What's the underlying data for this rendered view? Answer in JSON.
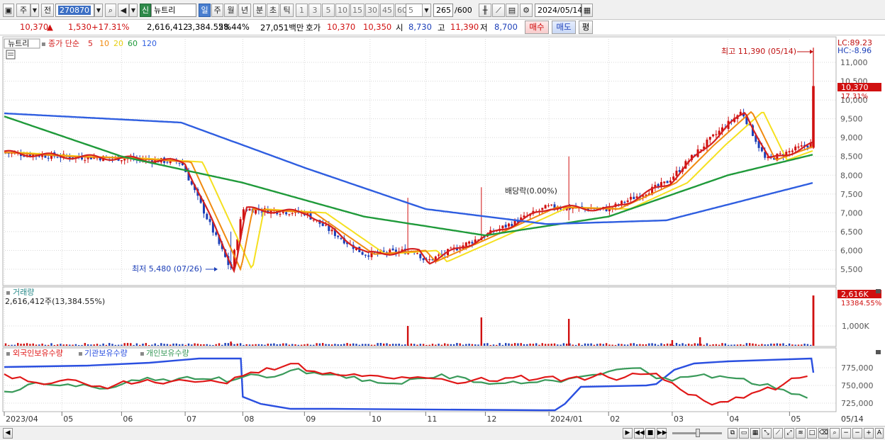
{
  "toolbar": {
    "period_week": "주",
    "prev_label": "전",
    "stock_code": "270870",
    "sin_label": "신",
    "stock_name": "뉴트리",
    "periods": [
      "일",
      "주",
      "월",
      "년",
      "분",
      "초",
      "틱"
    ],
    "active_period": "일",
    "intervals": [
      "1",
      "3",
      "5",
      "10",
      "15",
      "30",
      "45",
      "60"
    ],
    "interval_value": "5",
    "count_value": "265",
    "count_max": "/600",
    "date": "2024/05/14"
  },
  "quote": {
    "price": "10,370",
    "change_arrow": "▲",
    "change": "1,530",
    "change_pct": "+17.31%",
    "volume": "2,616,412",
    "volume_ratio": "3,384.55%",
    "turnover_ratio": "28.44%",
    "amount": "27,051백만",
    "hoga_label": "호가",
    "ask": "10,370",
    "bid": "10,350",
    "open_label": "시",
    "open": "8,730",
    "high_label": "고",
    "high": "11,390",
    "low_label": "저",
    "low": "8,700",
    "buy_button": "매수",
    "sell_button": "매도",
    "eval_button": "평"
  },
  "price_panel": {
    "stock_label": "뉴트리",
    "legend": {
      "close_label": "종가 단순",
      "ma5": "5",
      "ma10": "10",
      "ma20": "20",
      "ma60": "60",
      "ma120": "120"
    },
    "lc_label": "LC:89.23",
    "hc_label": "HC:-8.96",
    "high_annotation": "최고 11,390 (05/14)",
    "low_annotation": "최저 5,480 (07/26)",
    "dividend_annotation": "배당락(0.00%)",
    "current_price_tag": "10,370",
    "current_pct_tag": "17.31%",
    "y_ticks": [
      "11,000",
      "10,500",
      "10,000",
      "9,500",
      "9,000",
      "8,500",
      "8,000",
      "7,500",
      "7,000",
      "6,500",
      "6,000",
      "5,500"
    ]
  },
  "volume_panel": {
    "title": "거래량",
    "value_text": "2,616,412주(13,384.55%)",
    "current_tag": "2,616K",
    "ratio_tag": "13384.55%",
    "y_ticks": [
      "1,000K"
    ]
  },
  "holding_panel": {
    "legend_foreign": "외국인보유수량",
    "legend_institution": "기관보유수량",
    "legend_individual": "개인보유수량",
    "y_ticks": [
      "775,000",
      "750,000",
      "725,000"
    ]
  },
  "x_axis": {
    "labels": [
      "2023/04",
      "05",
      "06",
      "07",
      "08",
      "09",
      "10",
      "11",
      "12",
      "2024/01",
      "02",
      "03",
      "04",
      "05",
      "05/14"
    ]
  },
  "colors": {
    "up": "#d01010",
    "down": "#1c3fb8",
    "ma5": "#d42020",
    "ma10": "#f08a10",
    "ma20": "#f5e020",
    "ma60": "#1f9a3a",
    "ma120": "#2f5ee0",
    "foreign": "#e01818",
    "institution": "#2a4fe0",
    "individual": "#3a9a5a"
  },
  "chart_data": {
    "type": "line",
    "title": "",
    "x_range": [
      "2023/04",
      "2024/05/14"
    ],
    "ylim_price": [
      5300,
      11400
    ],
    "series": [
      {
        "name": "종가",
        "points": [
          [
            "2023/04",
            8600
          ],
          [
            "2023/05",
            8500
          ],
          [
            "2023/06",
            8450
          ],
          [
            "2023/07",
            8350
          ],
          [
            "2023/07/26",
            5480
          ],
          [
            "2023/08",
            7100
          ],
          [
            "2023/09",
            7000
          ],
          [
            "2023/10",
            5900
          ],
          [
            "2023/10/27",
            6000
          ],
          [
            "2023/11",
            5700
          ],
          [
            "2023/12",
            6400
          ],
          [
            "2024/01",
            7150
          ],
          [
            "2024/02",
            7100
          ],
          [
            "2024/03",
            7800
          ],
          [
            "2024/03/20",
            8800
          ],
          [
            "2024/04/08",
            9700
          ],
          [
            "2024/04/20",
            8400
          ],
          [
            "2024/05/13",
            8840
          ],
          [
            "2024/05/14",
            10370
          ]
        ]
      },
      {
        "name": "5",
        "points": [
          [
            "2023/04",
            8600
          ],
          [
            "2023/07/26",
            6200
          ],
          [
            "2023/08/15",
            7000
          ],
          [
            "2023/10/25",
            5900
          ],
          [
            "2023/11/15",
            5700
          ],
          [
            "2024/01",
            7100
          ],
          [
            "2024/04/08",
            9600
          ],
          [
            "2024/05/14",
            9100
          ]
        ]
      },
      {
        "name": "60",
        "points": [
          [
            "2023/04",
            9600
          ],
          [
            "2023/06",
            8500
          ],
          [
            "2023/08",
            7800
          ],
          [
            "2023/10",
            6900
          ],
          [
            "2023/12",
            6400
          ],
          [
            "2024/02",
            6900
          ],
          [
            "2024/04",
            8000
          ],
          [
            "2024/05/14",
            8550
          ]
        ]
      },
      {
        "name": "120",
        "points": [
          [
            "2023/04",
            9650
          ],
          [
            "2023/07",
            9400
          ],
          [
            "2023/09",
            8200
          ],
          [
            "2023/11",
            7100
          ],
          [
            "2024/01",
            6700
          ],
          [
            "2024/03",
            6800
          ],
          [
            "2024/05/14",
            7800
          ]
        ]
      }
    ],
    "volume": {
      "max_day": "2024/05/14",
      "max_value": 2616412
    }
  }
}
